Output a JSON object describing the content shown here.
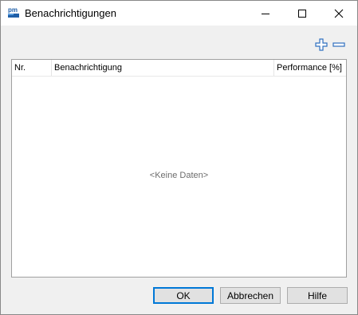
{
  "window": {
    "title": "Benachrichtigungen",
    "app_icon_text": "pm"
  },
  "toolbar": {
    "add_icon": "plus-icon",
    "remove_icon": "minus-icon",
    "accent_color": "#2f6fbf"
  },
  "table": {
    "columns": [
      "Nr.",
      "Benachrichtigung",
      "Performance [%]"
    ],
    "rows": [],
    "empty_text": "<Keine Daten>"
  },
  "buttons": {
    "ok_label": "OK",
    "cancel_label": "Abbrechen",
    "help_label": "Hilfe"
  }
}
